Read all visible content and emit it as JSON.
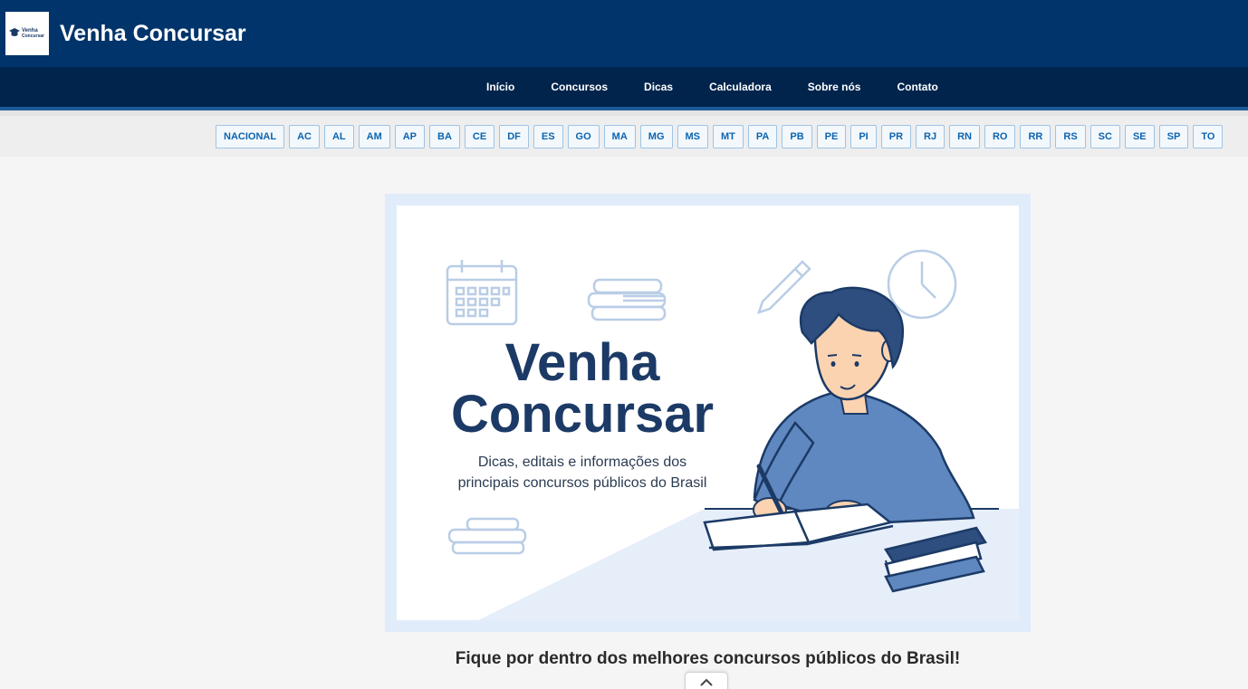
{
  "header": {
    "logo_text_line1": "Venha",
    "logo_text_line2": "Concursar",
    "title": "Venha Concursar"
  },
  "nav": {
    "items": [
      "Início",
      "Concursos",
      "Dicas",
      "Calculadora",
      "Sobre nós",
      "Contato"
    ]
  },
  "states": [
    "NACIONAL",
    "AC",
    "AL",
    "AM",
    "AP",
    "BA",
    "CE",
    "DF",
    "ES",
    "GO",
    "MA",
    "MG",
    "MS",
    "MT",
    "PA",
    "PB",
    "PE",
    "PI",
    "PR",
    "RJ",
    "RN",
    "RO",
    "RR",
    "RS",
    "SC",
    "SE",
    "SP",
    "TO"
  ],
  "hero": {
    "title_line1": "Venha",
    "title_line2": "Concursar",
    "subtitle_line1": "Dicas, editais e informações dos",
    "subtitle_line2": "principais concursos públicos do Brasil"
  },
  "tagline": "Fique por dentro dos melhores concursos públicos do Brasil!",
  "colors": {
    "topbar": "#00346b",
    "navbar": "#00244c",
    "state_button_text": "#0c64b0",
    "hero_title": "#1c3a66"
  },
  "icons": {
    "scroll_top": "chevron-up-icon"
  }
}
